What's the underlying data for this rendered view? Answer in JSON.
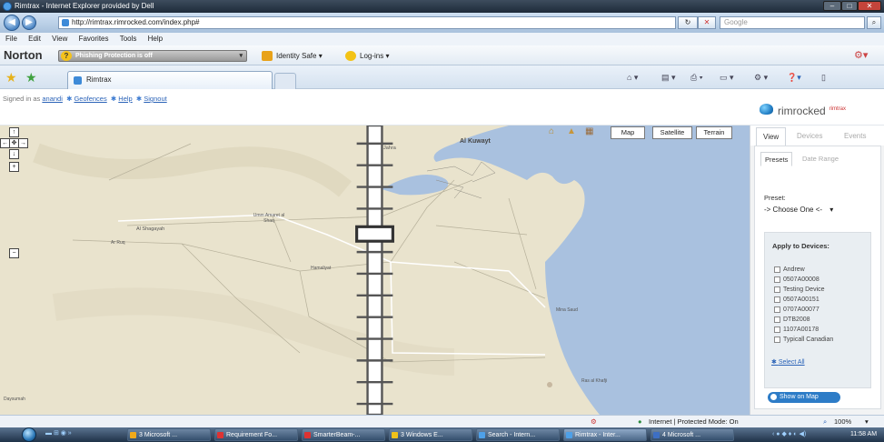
{
  "window": {
    "title": "Rimtrax - Internet Explorer provided by Dell"
  },
  "address_bar": {
    "url": "http://rimtrax.rimrocked.com/index.php#",
    "search_placeholder": "Google"
  },
  "menu": [
    "File",
    "Edit",
    "View",
    "Favorites",
    "Tools",
    "Help"
  ],
  "norton": {
    "brand": "Norton",
    "phishing_status": "Phishing Protection is off",
    "identity_safe": "Identity Safe ▾",
    "logins": "Log-ins ▾"
  },
  "tab": {
    "title": "Rimtrax"
  },
  "app": {
    "signed_in_prefix": "Signed in as",
    "username": "anandi",
    "links": [
      "Geofences",
      "Help",
      "Signout"
    ],
    "logo_text": "rimrocked",
    "logo_sub": "rimtrax"
  },
  "map": {
    "type_buttons": [
      "Map",
      "Satellite",
      "Terrain"
    ],
    "places": [
      "Jahra",
      "Al Kuwayt",
      "Al Shagayah",
      "Umm Amaret al Shaq",
      "Ar Ruq",
      "Hamaliyat",
      "Mina Saud",
      "Ras al Khafji",
      "Daysumah"
    ]
  },
  "panel": {
    "tabs": [
      "View",
      "Devices",
      "Events"
    ],
    "subtabs": [
      "Presets",
      "Date Range"
    ],
    "preset_label": "Preset:",
    "preset_value": "-> Choose One <-",
    "apply_header": "Apply to Devices:",
    "devices": [
      "Andrew",
      "0507A00008",
      "Testing Device",
      "0507A00151",
      "0707A00077",
      "DTB2008",
      "1107A00178",
      "Typicall Canadian"
    ],
    "select_all": "Select All",
    "show_on_map": "Show on Map"
  },
  "status": {
    "zone": "Internet | Protected Mode: On",
    "zoom": "100%"
  },
  "taskbar": {
    "items": [
      "3 Microsoft ...",
      "Requirement Fo...",
      "SmarterBeam-...",
      "3 Windows E...",
      "Search - Intern...",
      "Rimtrax - Inter...",
      "4 Microsoft ..."
    ],
    "time": "11:58 AM"
  }
}
